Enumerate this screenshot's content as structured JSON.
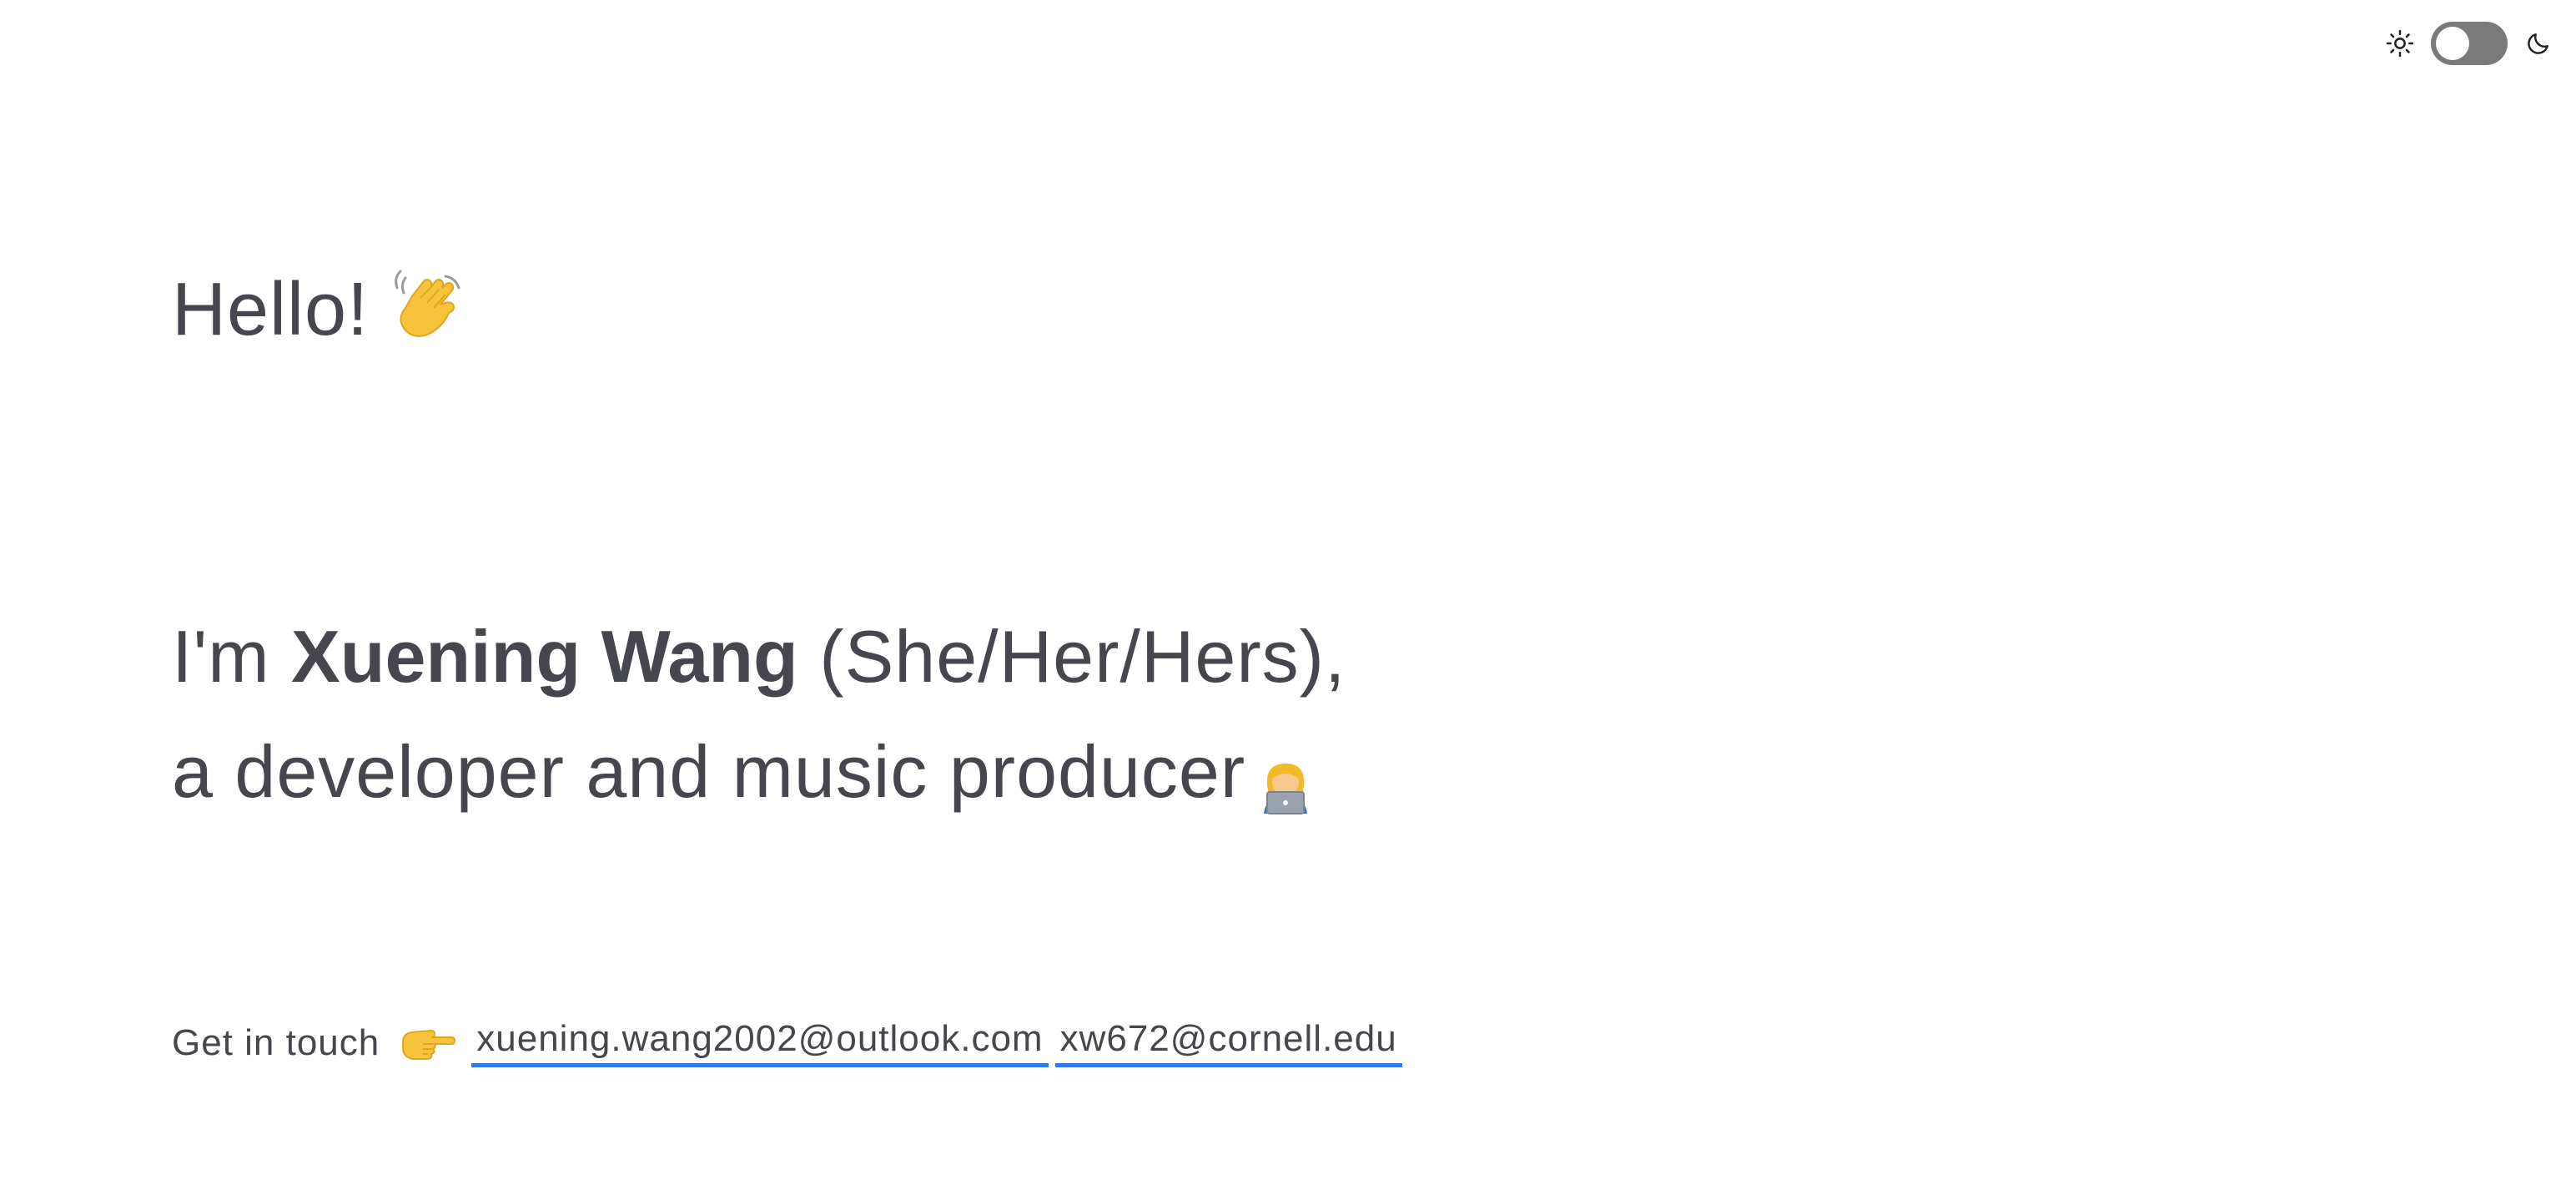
{
  "theme": {
    "mode": "light",
    "toggle_color": "#7a7a7a",
    "icons": {
      "light": "sun-icon",
      "dark": "moon-icon"
    }
  },
  "hero": {
    "greeting": "Hello!",
    "greeting_emoji": "waving-hand-icon"
  },
  "intro": {
    "prefix": "I'm",
    "name": "Xuening Wang",
    "pronouns": "(She/Her/Hers),",
    "tagline": "a developer and music producer",
    "tagline_emoji": "woman-technologist-icon"
  },
  "contact": {
    "label": "Get in touch",
    "label_emoji": "pointing-right-icon",
    "emails": [
      "xuening.wang2002@outlook.com",
      "xw672@cornell.edu"
    ],
    "link_color": "#2f7ae5"
  }
}
